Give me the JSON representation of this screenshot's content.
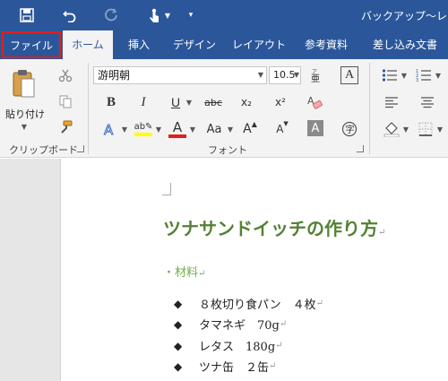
{
  "window": {
    "title": "バックアップ～レシピ"
  },
  "tabs": [
    {
      "label": "ファイル"
    },
    {
      "label": "ホーム"
    },
    {
      "label": "挿入"
    },
    {
      "label": "デザイン"
    },
    {
      "label": "レイアウト"
    },
    {
      "label": "参考資料"
    },
    {
      "label": "差し込み文書"
    }
  ],
  "clipboard": {
    "paste_label": "貼り付け",
    "group_label": "クリップボード"
  },
  "font": {
    "family": "游明朝",
    "size": "10.5",
    "group_label": "フォント",
    "bold": "B",
    "italic": "I",
    "underline": "U",
    "strike": "abc",
    "subscript": "x₂",
    "superscript": "x²",
    "case": "Aa",
    "grow": "A",
    "shrink": "A",
    "highlight_color": "#ffff00",
    "font_color": "#e0201b"
  },
  "document": {
    "heading": "ツナサンドイッチの作り方",
    "subheading": "・材料",
    "items": [
      "８枚切り食パン　４枚",
      "タマネギ　70g",
      "レタス　180g",
      "ツナ缶　２缶"
    ],
    "bullet": "◆",
    "para_mark": "↵"
  },
  "colors": {
    "accent": "#2b579a",
    "heading": "#538135",
    "subheading": "#70ad47"
  }
}
